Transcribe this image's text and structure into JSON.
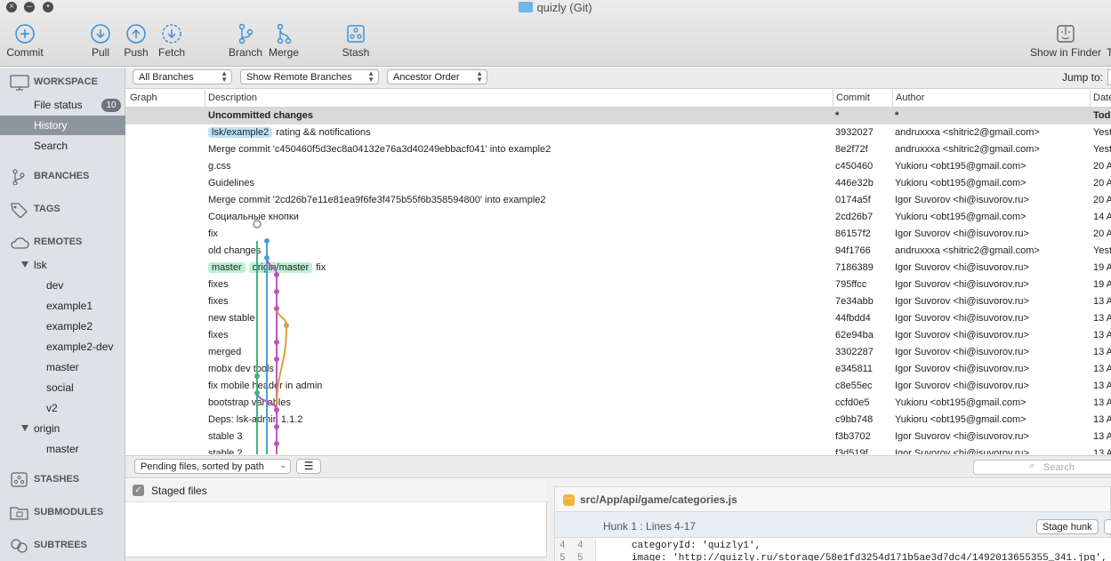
{
  "window": {
    "title": "quizly (Git)"
  },
  "toolbar": {
    "commit": "Commit",
    "pull": "Pull",
    "push": "Push",
    "fetch": "Fetch",
    "branch": "Branch",
    "merge": "Merge",
    "stash": "Stash",
    "show_in_finder": "Show in Finder",
    "cut_label": "T"
  },
  "sidebar": {
    "workspace": "WORKSPACE",
    "file_status": "File status",
    "file_status_count": "10",
    "history": "History",
    "search": "Search",
    "branches": "BRANCHES",
    "tags": "TAGS",
    "remotes": "REMOTES",
    "remote_lsk": "lsk",
    "lsk_branches": [
      "dev",
      "example1",
      "example2",
      "example2-dev",
      "master",
      "social",
      "v2"
    ],
    "remote_origin": "origin",
    "origin_branches": [
      "master"
    ],
    "stashes": "STASHES",
    "submodules": "SUBMODULES",
    "subtrees": "SUBTREES"
  },
  "filters": {
    "branches": "All Branches",
    "remote": "Show Remote Branches",
    "order": "Ancestor Order",
    "jump_to": "Jump to:"
  },
  "columns": {
    "graph": "Graph",
    "description": "Description",
    "commit": "Commit",
    "author": "Author",
    "date": "Date"
  },
  "commits": [
    {
      "tags": [],
      "desc": "Uncommitted changes",
      "sha": "*",
      "author": "*",
      "date": "Tod"
    },
    {
      "tags": [
        {
          "label": "lsk/example2",
          "color": "blue"
        }
      ],
      "desc": "rating && notifications",
      "sha": "3932027",
      "author": "andruxxxa <shitric2@gmail.com>",
      "date": "Yest"
    },
    {
      "tags": [],
      "desc": "Merge commit 'c450460f5d3ec8a04132e76a3d40249ebbacf041' into example2",
      "sha": "8e2f72f",
      "author": "andruxxxa <shitric2@gmail.com>",
      "date": "Yest"
    },
    {
      "tags": [],
      "desc": "g.css",
      "sha": "c450460",
      "author": "Yukioru <obt195@gmail.com>",
      "date": "20 A"
    },
    {
      "tags": [],
      "desc": "Guidelines",
      "sha": "446e32b",
      "author": "Yukioru <obt195@gmail.com>",
      "date": "20 A"
    },
    {
      "tags": [],
      "desc": "Merge commit '2cd26b7e11e81ea9f6fe3f475b55f6b358594800' into example2",
      "sha": "0174a5f",
      "author": "Igor Suvorov <hi@isuvorov.ru>",
      "date": "20 A"
    },
    {
      "tags": [],
      "desc": "Социальные кнопки",
      "sha": "2cd26b7",
      "author": "Yukioru <obt195@gmail.com>",
      "date": "14 A"
    },
    {
      "tags": [],
      "desc": "fix",
      "sha": "86157f2",
      "author": "Igor Suvorov <hi@isuvorov.ru>",
      "date": "20 A"
    },
    {
      "tags": [],
      "desc": "old changes",
      "sha": "94f1766",
      "author": "andruxxxa <shitric2@gmail.com>",
      "date": "Yest"
    },
    {
      "tags": [
        {
          "label": "master",
          "color": "green"
        },
        {
          "label": "origin/master",
          "color": "green"
        }
      ],
      "desc": "fix",
      "sha": "7186389",
      "author": "Igor Suvorov <hi@isuvorov.ru>",
      "date": "19 A"
    },
    {
      "tags": [],
      "desc": "fixes",
      "sha": "795ffcc",
      "author": "Igor Suvorov <hi@isuvorov.ru>",
      "date": "19 A"
    },
    {
      "tags": [],
      "desc": "fixes",
      "sha": "7e34abb",
      "author": "Igor Suvorov <hi@isuvorov.ru>",
      "date": "13 A"
    },
    {
      "tags": [],
      "desc": "new stable",
      "sha": "44fbdd4",
      "author": "Igor Suvorov <hi@isuvorov.ru>",
      "date": "13 A"
    },
    {
      "tags": [],
      "desc": "fixes",
      "sha": "62e94ba",
      "author": "Igor Suvorov <hi@isuvorov.ru>",
      "date": "13 A"
    },
    {
      "tags": [],
      "desc": "merged",
      "sha": "3302287",
      "author": "Igor Suvorov <hi@isuvorov.ru>",
      "date": "13 A"
    },
    {
      "tags": [],
      "desc": "mobx dev tools",
      "sha": "e345811",
      "author": "Igor Suvorov <hi@isuvorov.ru>",
      "date": "13 A"
    },
    {
      "tags": [],
      "desc": "fix mobile header in admin",
      "sha": "c8e55ec",
      "author": "Igor Suvorov <hi@isuvorov.ru>",
      "date": "13 A"
    },
    {
      "tags": [],
      "desc": "bootstrap variables",
      "sha": "ccfd0e5",
      "author": "Yukioru <obt195@gmail.com>",
      "date": "13 A"
    },
    {
      "tags": [],
      "desc": "Deps: lsk-admin 1.1.2",
      "sha": "c9bb748",
      "author": "Yukioru <obt195@gmail.com>",
      "date": "13 A"
    },
    {
      "tags": [],
      "desc": "stable 3",
      "sha": "f3b3702",
      "author": "Igor Suvorov <hi@isuvorov.ru>",
      "date": "13 A"
    },
    {
      "tags": [],
      "desc": "stable 2",
      "sha": "f3d519f",
      "author": "Igor Suvorov <hi@isuvorov.ru>",
      "date": "13 A"
    }
  ],
  "graph_lanes": [
    0,
    1,
    1,
    2,
    2,
    2,
    3,
    2,
    2,
    0,
    0,
    2,
    2,
    2,
    0,
    2,
    2,
    2,
    2,
    2,
    2
  ],
  "graph_colors": [
    "#3fb27f",
    "#4a9fd0",
    "#c252c0",
    "#d8a23a"
  ],
  "pending": {
    "sort": "Pending files, sorted by path",
    "search_placeholder": "Search"
  },
  "staged": {
    "label": "Staged files"
  },
  "diff": {
    "file": "src/App/api/game/categories.js",
    "hunk": "Hunk 1 : Lines 4-17",
    "stage_hunk": "Stage hunk",
    "lines": [
      {
        "old": "4",
        "new": "4",
        "text": "categoryId: 'quizly1',"
      },
      {
        "old": "5",
        "new": "5",
        "text": "image: 'http://quizly.ru/storage/58e1fd3254d171b5ae3d7dc4/1492013655355_341.jpg',"
      }
    ]
  }
}
